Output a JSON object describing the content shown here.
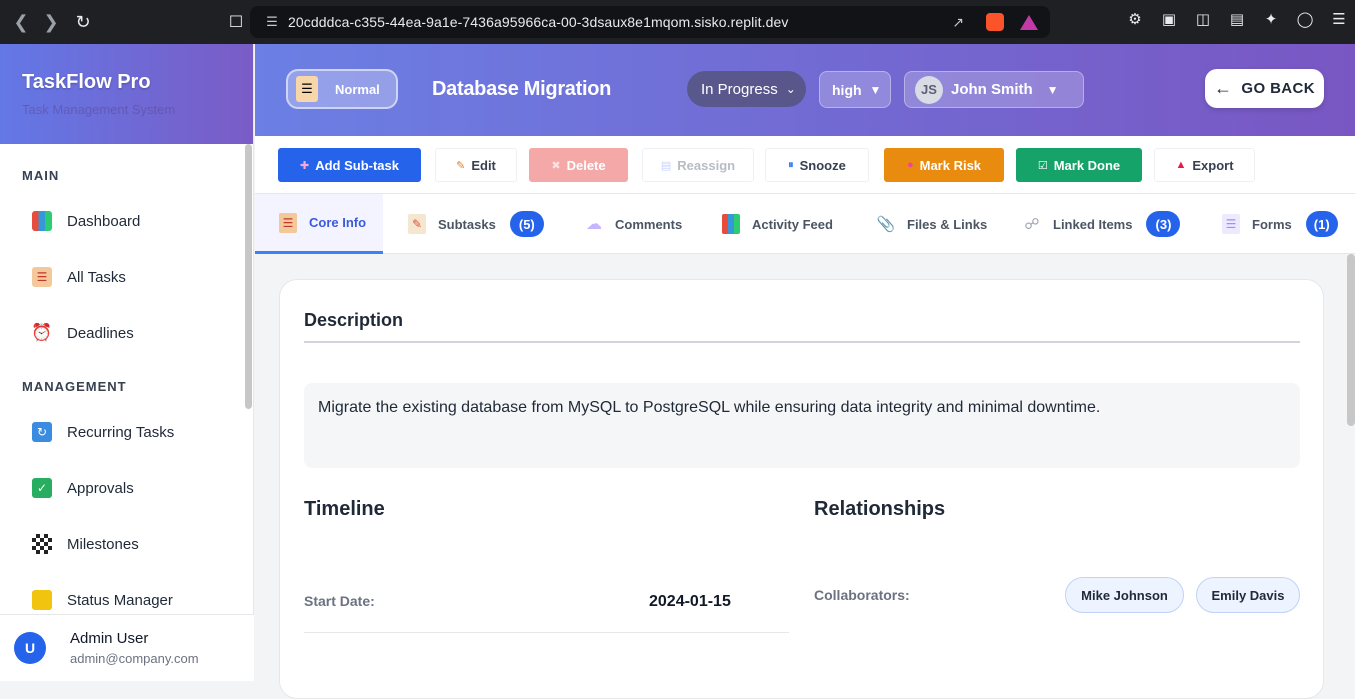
{
  "browser": {
    "url": "20cdddca-c355-44ea-9a1e-7436a95966ca-00-3dsaux8e1mqom.sisko.replit.dev"
  },
  "sidebar": {
    "brand_title": "TaskFlow Pro",
    "brand_subtitle": "Task Management System",
    "sections": [
      {
        "label": "MAIN",
        "items": [
          {
            "label": "Dashboard",
            "icon": "bar-chart-icon"
          },
          {
            "label": "All Tasks",
            "icon": "clipboard-icon"
          },
          {
            "label": "Deadlines",
            "icon": "alarm-clock-icon"
          }
        ]
      },
      {
        "label": "MANAGEMENT",
        "items": [
          {
            "label": "Recurring Tasks",
            "icon": "repeat-icon"
          },
          {
            "label": "Approvals",
            "icon": "check-box-icon"
          },
          {
            "label": "Milestones",
            "icon": "checkered-flag-icon"
          },
          {
            "label": "Status Manager",
            "icon": "label-icon"
          }
        ]
      }
    ],
    "user": {
      "initial": "U",
      "name": "Admin User",
      "email": "admin@company.com"
    }
  },
  "header": {
    "priority_pill": "Normal",
    "task_title": "Database Migration",
    "status": "In Progress",
    "priority": "high",
    "assignee_initials": "JS",
    "assignee": "John Smith",
    "go_back": "GO BACK"
  },
  "toolbar": {
    "add_subtask": "Add Sub-task",
    "edit": "Edit",
    "delete": "Delete",
    "reassign": "Reassign",
    "snooze": "Snooze",
    "mark_risk": "Mark Risk",
    "mark_done": "Mark Done",
    "export": "Export"
  },
  "tabs": {
    "core_info": "Core Info",
    "subtasks": "Subtasks",
    "subtasks_count": "(5)",
    "comments": "Comments",
    "activity_feed": "Activity Feed",
    "files_links": "Files & Links",
    "linked_items": "Linked Items",
    "linked_items_count": "(3)",
    "forms": "Forms",
    "forms_count": "(1)"
  },
  "content": {
    "description_heading": "Description",
    "description_text": "Migrate the existing database from MySQL to PostgreSQL while ensuring data integrity and minimal downtime.",
    "timeline_heading": "Timeline",
    "relationships_heading": "Relationships",
    "start_date_label": "Start Date:",
    "start_date_value": "2024-01-15",
    "collaborators_label": "Collaborators:",
    "collaborators": [
      "Mike Johnson",
      "Emily Davis"
    ]
  },
  "colors": {
    "header_gradient_start": "#6b7fe4",
    "header_gradient_end": "#7957c3",
    "primary": "#2563eb",
    "delete": "#f4a8a8",
    "risk": "#e98b0f",
    "done": "#16a36a"
  }
}
